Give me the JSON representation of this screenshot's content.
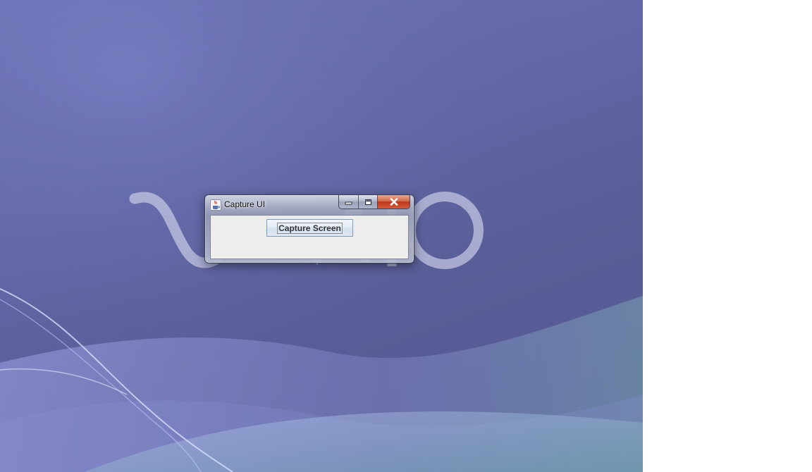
{
  "window": {
    "title": "Capture UI",
    "icon": "java-coffee-icon",
    "controls": {
      "minimize_icon": "minimize-icon",
      "maximize_icon": "maximize-icon",
      "close_icon": "close-icon"
    }
  },
  "content": {
    "capture_button_label": "Capture Screen"
  },
  "wallpaper": {
    "logo_icon": "vaio-logo-icon"
  },
  "colors": {
    "desktop_background": "#6268a8",
    "close_button": "#c0391c",
    "panel_background": "#ededed",
    "button_border": "#7a9ac2"
  }
}
